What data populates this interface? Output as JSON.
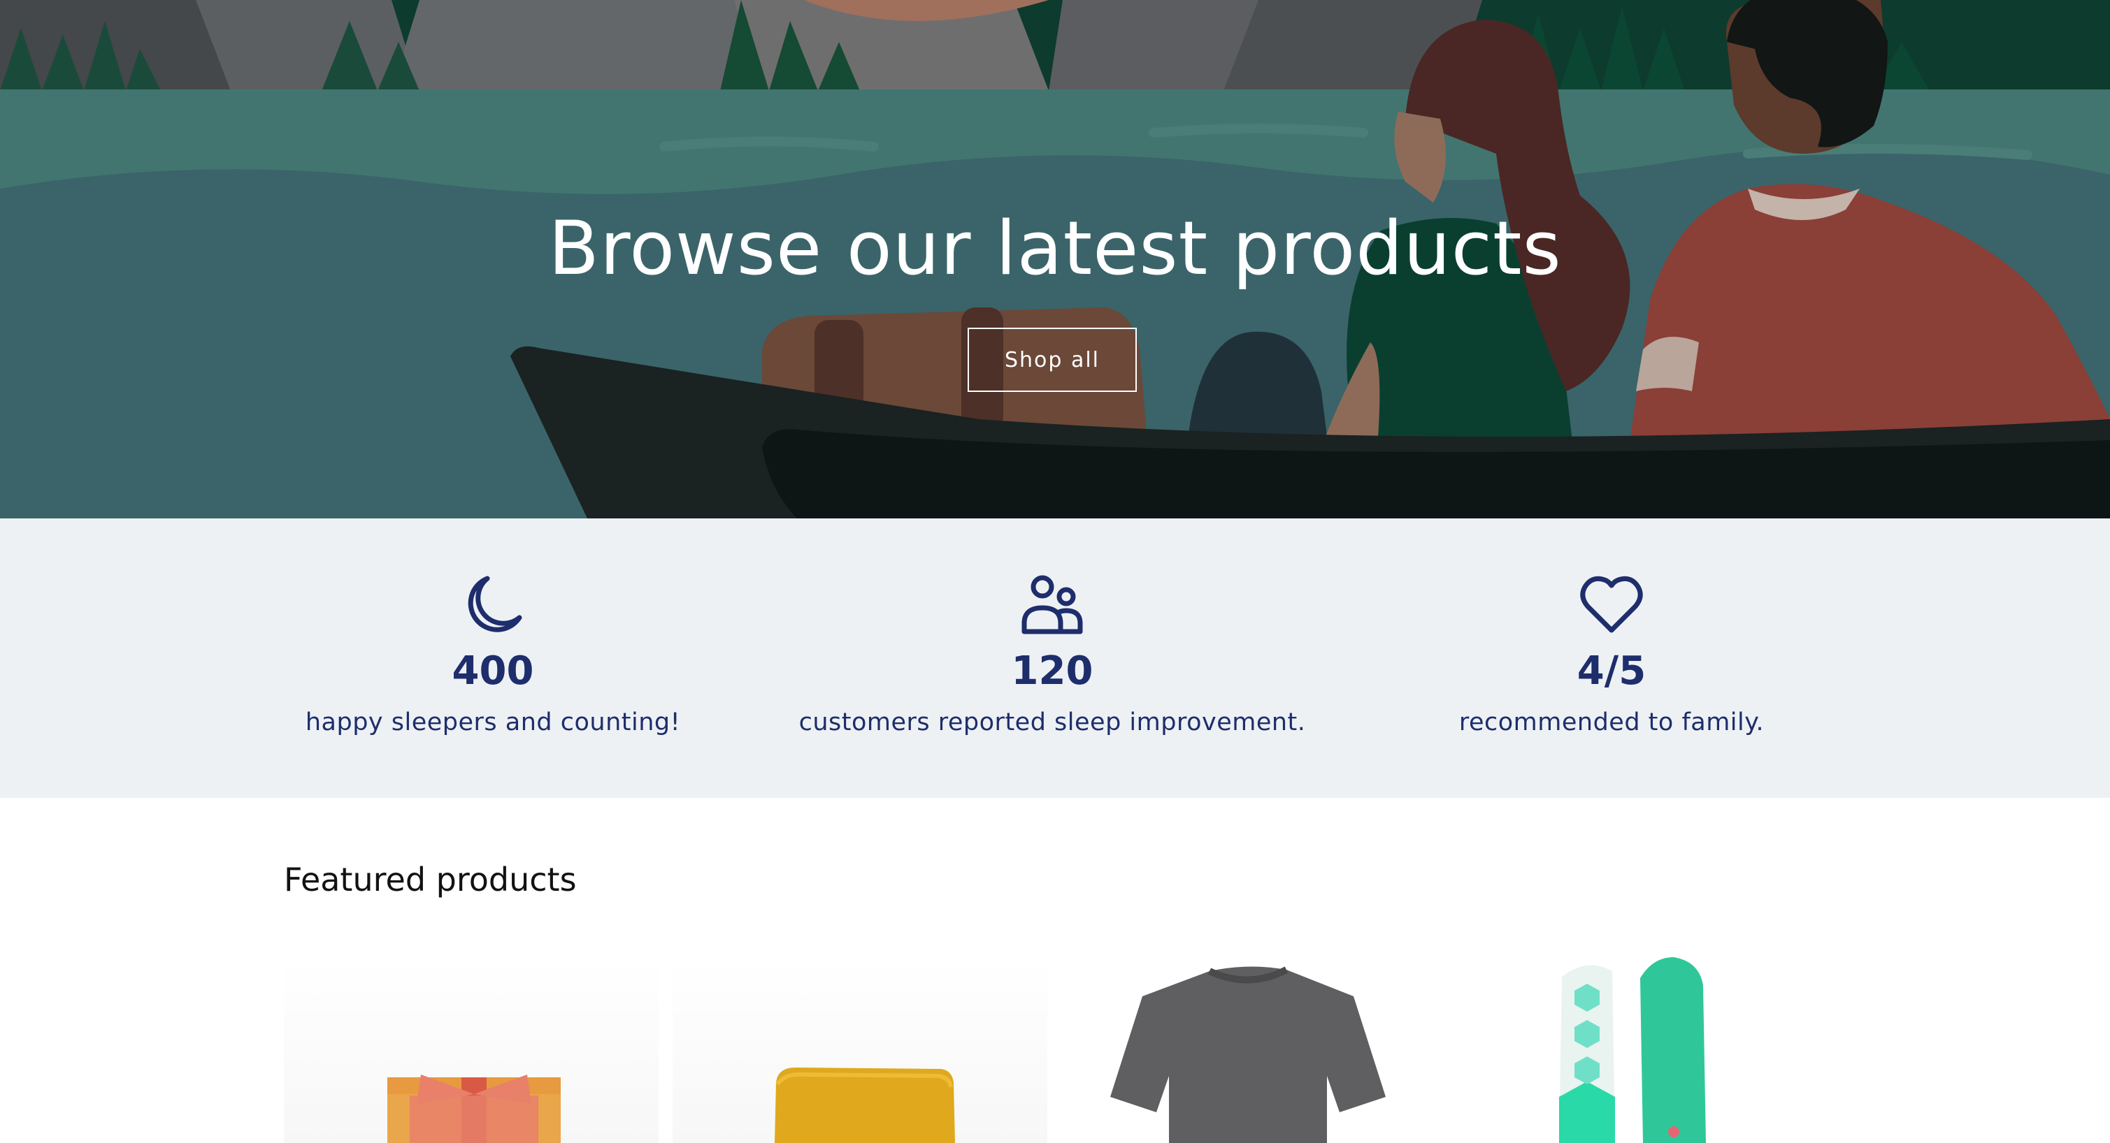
{
  "hero": {
    "title": "Browse our latest products",
    "button_label": "Shop all"
  },
  "stats": [
    {
      "icon": "moon-icon",
      "value": "400",
      "label": "happy sleepers and counting!"
    },
    {
      "icon": "people-icon",
      "value": "120",
      "label": "customers reported sleep improvement."
    },
    {
      "icon": "heart-icon",
      "value": "4/5",
      "label": "recommended to family."
    }
  ],
  "featured": {
    "title": "Featured products",
    "products": [
      {
        "image": "gift-box-image"
      },
      {
        "image": "soap-bar-image"
      },
      {
        "image": "tshirt-image"
      },
      {
        "image": "snowboard-image"
      }
    ]
  },
  "colors": {
    "accent": "#1e2d6b",
    "stats_background": "#edf1f4",
    "lake": "#3d6e6b"
  }
}
